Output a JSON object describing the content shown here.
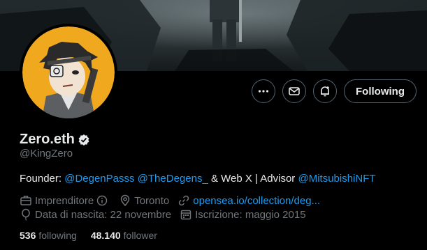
{
  "profile": {
    "display_name": "Zero.eth",
    "handle": "@KingZero",
    "verified": true
  },
  "actions": {
    "more_icon": "more-horizontal-icon",
    "message_icon": "envelope-icon",
    "notify_icon": "bell-plus-icon",
    "following_label": "Following"
  },
  "bio": {
    "prefix": "Founder: ",
    "mention1": "@DegenPasss",
    "space1": " ",
    "mention2": "@TheDegens_",
    "middle": " & Web X | Advisor ",
    "mention3": "@MitsubishiNFT"
  },
  "meta": {
    "occupation": "Imprenditore",
    "location": "Toronto",
    "website": "opensea.io/collection/deg...",
    "birthday": "Data di nascita: 22 novembre",
    "joined": "Iscrizione: maggio 2015"
  },
  "stats": {
    "following_count": "536",
    "following_label": "following",
    "followers_count": "48.140",
    "followers_label": "follower"
  },
  "colors": {
    "background": "#000000",
    "text_primary": "#e7e9ea",
    "text_secondary": "#71767b",
    "link": "#1d9bf0",
    "border": "#536471",
    "avatar_bg": "#f0a81e"
  }
}
